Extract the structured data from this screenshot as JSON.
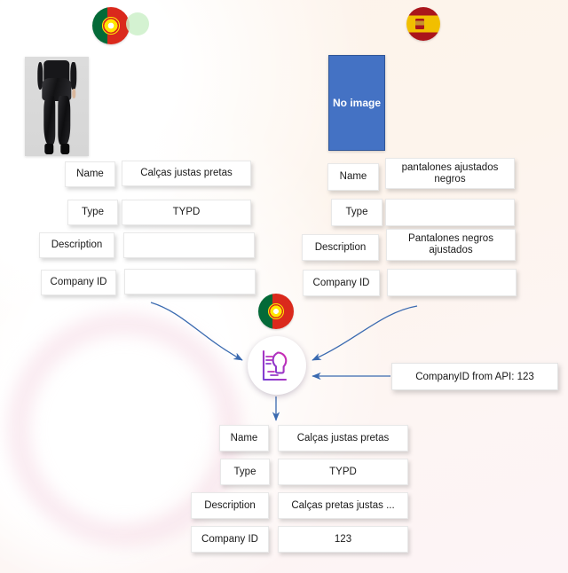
{
  "background": {
    "base_color": "#fdf4ec",
    "accent_pink": "#f0bed2",
    "accent_blue": "#4472C4"
  },
  "sources": [
    {
      "id": "source-pt",
      "locale_icon": "flag-portugal-icon",
      "locale_name": "Portugal",
      "image_kind": "product-photo",
      "image_alt": "black leather leggings",
      "fields": [
        {
          "label": "Name",
          "value": "Calças justas pretas"
        },
        {
          "label": "Type",
          "value": "TYPD"
        },
        {
          "label": "Description",
          "value": ""
        },
        {
          "label": "Company ID",
          "value": ""
        }
      ]
    },
    {
      "id": "source-es",
      "locale_icon": "flag-spain-icon",
      "locale_name": "Spain",
      "image_kind": "no-image-placeholder",
      "image_placeholder_text": "No image",
      "fields": [
        {
          "label": "Name",
          "value": "pantalones ajustados negros"
        },
        {
          "label": "Type",
          "value": ""
        },
        {
          "label": "Description",
          "value": "Pantalones negros ajustados"
        },
        {
          "label": "Company ID",
          "value": ""
        }
      ]
    }
  ],
  "hub": {
    "icon": "idea-lightbulb-icon",
    "locale_icon": "flag-portugal-icon",
    "locale_name": "Portugal"
  },
  "api_callout": {
    "text": "CompanyID from API: 123"
  },
  "result": {
    "id": "merged-result",
    "fields": [
      {
        "label": "Name",
        "value": "Calças justas pretas"
      },
      {
        "label": "Type",
        "value": "TYPD"
      },
      {
        "label": "Description",
        "value": "Calças pretas justas ..."
      },
      {
        "label": "Company ID",
        "value": "123"
      }
    ]
  }
}
